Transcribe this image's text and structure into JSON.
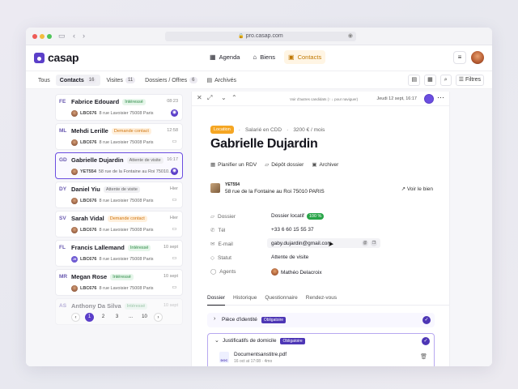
{
  "browser": {
    "url": "pro.casap.com"
  },
  "app": {
    "logo": "casap"
  },
  "topnav": [
    {
      "label": "Agenda",
      "icon": "calendar-icon"
    },
    {
      "label": "Biens",
      "icon": "home-icon"
    },
    {
      "label": "Contacts",
      "icon": "contacts-icon",
      "active": true
    }
  ],
  "filters": {
    "tabs": [
      {
        "label": "Tous",
        "count": ""
      },
      {
        "label": "Contacts",
        "count": "16"
      },
      {
        "label": "Visites",
        "count": "11"
      },
      {
        "label": "Dossiers / Offres",
        "count": "6"
      },
      {
        "label": "Archivés",
        "count": ""
      }
    ],
    "filter_label": "Filtres"
  },
  "contacts": [
    {
      "initials": "FE",
      "name": "Fabrice Edouard",
      "badge": "Intéressé",
      "badge_color": "green",
      "time": "08:23",
      "ref": "LBC676",
      "address": "8 rue Lavoisier 75008 Paris",
      "icon": "filled"
    },
    {
      "initials": "ML",
      "name": "Mehdi Lerille",
      "badge": "Demande contact",
      "badge_color": "orange",
      "time": "12:58",
      "ref": "LBC676",
      "address": "8 rue Lavoisier 75008 Paris",
      "icon": "chat"
    },
    {
      "initials": "GD",
      "name": "Gabrielle Dujardin",
      "badge": "Attente de visite",
      "badge_color": "grey",
      "time": "16:17",
      "ref": "YET554",
      "address": "58 rue de la Fontaine au Roi 75010...",
      "icon": "filled",
      "selected": true
    },
    {
      "initials": "DY",
      "name": "Daniel Yiu",
      "badge": "Attente de visite",
      "badge_color": "grey",
      "time": "Hier",
      "ref": "LBC676",
      "address": "8 rue Lavoisier 75008 Paris",
      "icon": "chat"
    },
    {
      "initials": "SV",
      "name": "Sarah Vidal",
      "badge": "Demande contact",
      "badge_color": "orange",
      "time": "Hier",
      "ref": "LBC676",
      "address": "8 rue Lavoisier 75008 Paris",
      "icon": "chat"
    },
    {
      "initials": "FL",
      "name": "Francis Lallemand",
      "badge": "Intéressé",
      "badge_color": "green",
      "time": "10 sept",
      "ref": "LBC676",
      "address": "8 rue Lavoisier 75008 Paris",
      "icon": "chat",
      "avatar_initials": "JH"
    },
    {
      "initials": "MR",
      "name": "Megan Rose",
      "badge": "Intéressé",
      "badge_color": "green",
      "time": "10 sept",
      "ref": "LBC676",
      "address": "8 rue Lavoisier 75008 Paris",
      "icon": "chat"
    },
    {
      "initials": "AS",
      "name": "Anthony Da Silva",
      "badge": "Intéressé",
      "badge_color": "green",
      "time": "10 sept",
      "ref": "",
      "address": "",
      "icon": "",
      "faded": true
    }
  ],
  "pagination": {
    "pages": [
      "1",
      "2",
      "3",
      "...",
      "10"
    ],
    "current": "1"
  },
  "detail": {
    "nav_hint": "Voir d'autres candidats (↑ ↓ pour naviguer)",
    "date": "Jeudi 12 sept, 16:17",
    "tag": "Location",
    "employment": "Salarié en CDD",
    "income": "3200 € / mois",
    "name": "Gabrielle Dujardin",
    "actions": {
      "rdv": "Planifier un RDV",
      "deposit": "Dépôt dossier",
      "archive": "Archiver"
    },
    "property": {
      "ref": "YET554",
      "address": "58 rue de la Fontaine au Roi 75010 PARIS",
      "see": "Voir le bien"
    },
    "fields": {
      "dossier_label": "Dossier",
      "dossier_value": "Dossier locatif",
      "dossier_pct": "100 %",
      "tel_label": "Tél",
      "tel_value": "+33 6 60 15 55 37",
      "email_label": "E-mail",
      "email_value": "gaby.dujardin@gmail.com",
      "status_label": "Statut",
      "status_value": "Attente de visite",
      "agents_label": "Agents",
      "agents_value": "Mathéo Delacroix"
    },
    "tabs": [
      "Dossier",
      "Historique",
      "Questionnaire",
      "Rendez-vous"
    ],
    "docs": {
      "id_title": "Pièce d'identité",
      "home_title": "Justificatifs de domicile",
      "required": "Obligatoire",
      "file_name": "Documentsanstitre.pdf",
      "file_meta": "16 oct at 17:08 · 4mo",
      "file_type": "DOC"
    }
  },
  "colors": {
    "accent": "#5b3fc9",
    "contacts_active_bg": "#fff5e4",
    "location_tag": "#f5a623",
    "ok_green": "#27a447"
  }
}
